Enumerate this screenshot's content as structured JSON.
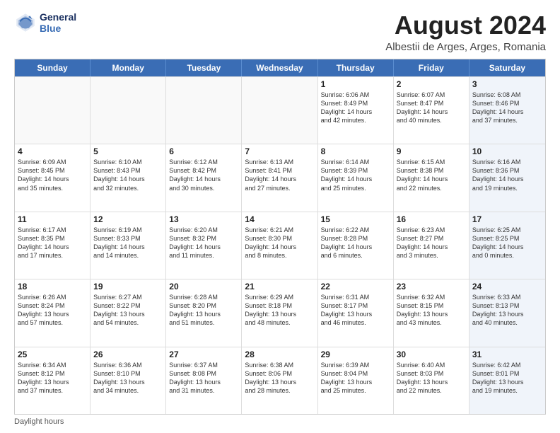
{
  "logo": {
    "line1": "General",
    "line2": "Blue"
  },
  "title": "August 2024",
  "subtitle": "Albestii de Arges, Arges, Romania",
  "header_days": [
    "Sunday",
    "Monday",
    "Tuesday",
    "Wednesday",
    "Thursday",
    "Friday",
    "Saturday"
  ],
  "footer": "Daylight hours",
  "rows": [
    [
      {
        "day": "",
        "text": "",
        "empty": true
      },
      {
        "day": "",
        "text": "",
        "empty": true
      },
      {
        "day": "",
        "text": "",
        "empty": true
      },
      {
        "day": "",
        "text": "",
        "empty": true
      },
      {
        "day": "1",
        "text": "Sunrise: 6:06 AM\nSunset: 8:49 PM\nDaylight: 14 hours\nand 42 minutes.",
        "shaded": false
      },
      {
        "day": "2",
        "text": "Sunrise: 6:07 AM\nSunset: 8:47 PM\nDaylight: 14 hours\nand 40 minutes.",
        "shaded": false
      },
      {
        "day": "3",
        "text": "Sunrise: 6:08 AM\nSunset: 8:46 PM\nDaylight: 14 hours\nand 37 minutes.",
        "shaded": true
      }
    ],
    [
      {
        "day": "4",
        "text": "Sunrise: 6:09 AM\nSunset: 8:45 PM\nDaylight: 14 hours\nand 35 minutes.",
        "shaded": false
      },
      {
        "day": "5",
        "text": "Sunrise: 6:10 AM\nSunset: 8:43 PM\nDaylight: 14 hours\nand 32 minutes.",
        "shaded": false
      },
      {
        "day": "6",
        "text": "Sunrise: 6:12 AM\nSunset: 8:42 PM\nDaylight: 14 hours\nand 30 minutes.",
        "shaded": false
      },
      {
        "day": "7",
        "text": "Sunrise: 6:13 AM\nSunset: 8:41 PM\nDaylight: 14 hours\nand 27 minutes.",
        "shaded": false
      },
      {
        "day": "8",
        "text": "Sunrise: 6:14 AM\nSunset: 8:39 PM\nDaylight: 14 hours\nand 25 minutes.",
        "shaded": false
      },
      {
        "day": "9",
        "text": "Sunrise: 6:15 AM\nSunset: 8:38 PM\nDaylight: 14 hours\nand 22 minutes.",
        "shaded": false
      },
      {
        "day": "10",
        "text": "Sunrise: 6:16 AM\nSunset: 8:36 PM\nDaylight: 14 hours\nand 19 minutes.",
        "shaded": true
      }
    ],
    [
      {
        "day": "11",
        "text": "Sunrise: 6:17 AM\nSunset: 8:35 PM\nDaylight: 14 hours\nand 17 minutes.",
        "shaded": false
      },
      {
        "day": "12",
        "text": "Sunrise: 6:19 AM\nSunset: 8:33 PM\nDaylight: 14 hours\nand 14 minutes.",
        "shaded": false
      },
      {
        "day": "13",
        "text": "Sunrise: 6:20 AM\nSunset: 8:32 PM\nDaylight: 14 hours\nand 11 minutes.",
        "shaded": false
      },
      {
        "day": "14",
        "text": "Sunrise: 6:21 AM\nSunset: 8:30 PM\nDaylight: 14 hours\nand 8 minutes.",
        "shaded": false
      },
      {
        "day": "15",
        "text": "Sunrise: 6:22 AM\nSunset: 8:28 PM\nDaylight: 14 hours\nand 6 minutes.",
        "shaded": false
      },
      {
        "day": "16",
        "text": "Sunrise: 6:23 AM\nSunset: 8:27 PM\nDaylight: 14 hours\nand 3 minutes.",
        "shaded": false
      },
      {
        "day": "17",
        "text": "Sunrise: 6:25 AM\nSunset: 8:25 PM\nDaylight: 14 hours\nand 0 minutes.",
        "shaded": true
      }
    ],
    [
      {
        "day": "18",
        "text": "Sunrise: 6:26 AM\nSunset: 8:24 PM\nDaylight: 13 hours\nand 57 minutes.",
        "shaded": false
      },
      {
        "day": "19",
        "text": "Sunrise: 6:27 AM\nSunset: 8:22 PM\nDaylight: 13 hours\nand 54 minutes.",
        "shaded": false
      },
      {
        "day": "20",
        "text": "Sunrise: 6:28 AM\nSunset: 8:20 PM\nDaylight: 13 hours\nand 51 minutes.",
        "shaded": false
      },
      {
        "day": "21",
        "text": "Sunrise: 6:29 AM\nSunset: 8:18 PM\nDaylight: 13 hours\nand 48 minutes.",
        "shaded": false
      },
      {
        "day": "22",
        "text": "Sunrise: 6:31 AM\nSunset: 8:17 PM\nDaylight: 13 hours\nand 46 minutes.",
        "shaded": false
      },
      {
        "day": "23",
        "text": "Sunrise: 6:32 AM\nSunset: 8:15 PM\nDaylight: 13 hours\nand 43 minutes.",
        "shaded": false
      },
      {
        "day": "24",
        "text": "Sunrise: 6:33 AM\nSunset: 8:13 PM\nDaylight: 13 hours\nand 40 minutes.",
        "shaded": true
      }
    ],
    [
      {
        "day": "25",
        "text": "Sunrise: 6:34 AM\nSunset: 8:12 PM\nDaylight: 13 hours\nand 37 minutes.",
        "shaded": false
      },
      {
        "day": "26",
        "text": "Sunrise: 6:36 AM\nSunset: 8:10 PM\nDaylight: 13 hours\nand 34 minutes.",
        "shaded": false
      },
      {
        "day": "27",
        "text": "Sunrise: 6:37 AM\nSunset: 8:08 PM\nDaylight: 13 hours\nand 31 minutes.",
        "shaded": false
      },
      {
        "day": "28",
        "text": "Sunrise: 6:38 AM\nSunset: 8:06 PM\nDaylight: 13 hours\nand 28 minutes.",
        "shaded": false
      },
      {
        "day": "29",
        "text": "Sunrise: 6:39 AM\nSunset: 8:04 PM\nDaylight: 13 hours\nand 25 minutes.",
        "shaded": false
      },
      {
        "day": "30",
        "text": "Sunrise: 6:40 AM\nSunset: 8:03 PM\nDaylight: 13 hours\nand 22 minutes.",
        "shaded": false
      },
      {
        "day": "31",
        "text": "Sunrise: 6:42 AM\nSunset: 8:01 PM\nDaylight: 13 hours\nand 19 minutes.",
        "shaded": true
      }
    ]
  ]
}
